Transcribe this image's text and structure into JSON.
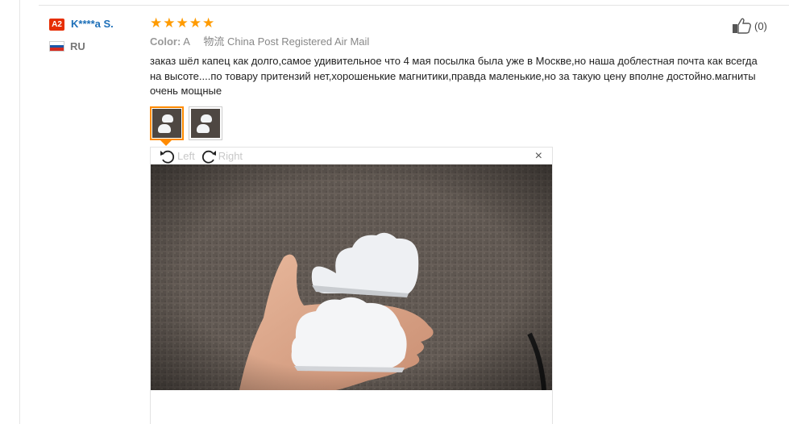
{
  "reviewer": {
    "level_badge": "A2",
    "name": "K****a S.",
    "country_code": "RU",
    "flag_colors": [
      "#ffffff",
      "#1c57a7",
      "#d52b1e"
    ]
  },
  "review": {
    "rating": 5,
    "stars": [
      "★",
      "★",
      "★",
      "★",
      "★"
    ],
    "color_label": "Color:",
    "color_value": "A",
    "shipping": "物流 China Post Registered Air Mail",
    "text": "заказ шёл капец как долго,самое удивительное что 4 мая посылка была уже в Москве,но наша доблестная почта как всегда на высоте....по товару притензий нет,хорошенькие магнитики,правда маленькие,но за такую цену вполне достойно.магниты очень мощные"
  },
  "helpful": {
    "count": "(0)",
    "icon": "thumbs-up-icon"
  },
  "thumbnails": [
    {
      "name": "photo-thumbnail-1",
      "active": true
    },
    {
      "name": "photo-thumbnail-2",
      "active": false
    }
  ],
  "viewer": {
    "rotate_left_label": "Left",
    "rotate_right_label": "Right",
    "close_glyph": "×"
  },
  "colors": {
    "accent": "#ff8a00",
    "star": "#ff9b00",
    "link": "#1d6fb8",
    "badge": "#e62e04"
  }
}
